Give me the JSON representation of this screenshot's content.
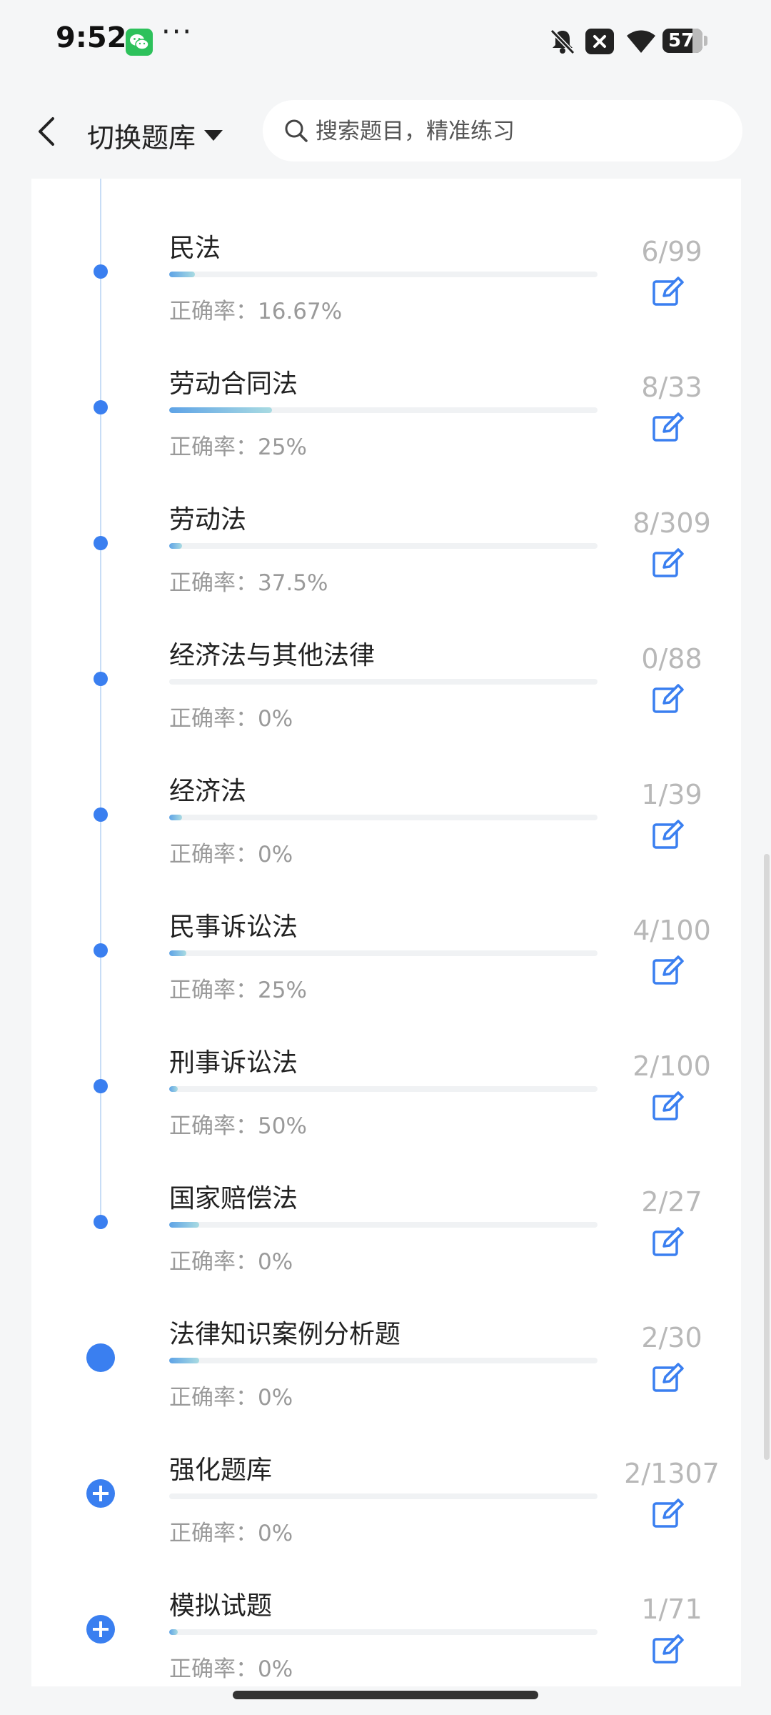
{
  "status_bar": {
    "time": "9:52",
    "dots": "···",
    "battery": "57",
    "icons": [
      "wechat-icon",
      "bell-muted-icon",
      "x-notification-icon",
      "wifi-icon",
      "battery-icon"
    ]
  },
  "header": {
    "switch_label": "切换题库",
    "search_placeholder": "搜索题目，精准练习"
  },
  "colors": {
    "accent": "#3a7ff0",
    "bar_start": "#5ea3e6",
    "bar_end": "#a9dbe2",
    "muted_text": "#9a9a9a",
    "count_text": "#b8b8b8"
  },
  "items": [
    {
      "title": "民法",
      "accuracy": "正确率：16.67%",
      "count": "6/99",
      "marker": "dot",
      "progress": 0.06
    },
    {
      "title": "劳动合同法",
      "accuracy": "正确率：25%",
      "count": "8/33",
      "marker": "dot",
      "progress": 0.24
    },
    {
      "title": "劳动法",
      "accuracy": "正确率：37.5%",
      "count": "8/309",
      "marker": "dot",
      "progress": 0.03
    },
    {
      "title": "经济法与其他法律",
      "accuracy": "正确率：0%",
      "count": "0/88",
      "marker": "dot",
      "progress": 0.0
    },
    {
      "title": "经济法",
      "accuracy": "正确率：0%",
      "count": "1/39",
      "marker": "dot",
      "progress": 0.03
    },
    {
      "title": "民事诉讼法",
      "accuracy": "正确率：25%",
      "count": "4/100",
      "marker": "dot",
      "progress": 0.04
    },
    {
      "title": "刑事诉讼法",
      "accuracy": "正确率：50%",
      "count": "2/100",
      "marker": "dot",
      "progress": 0.02
    },
    {
      "title": "国家赔偿法",
      "accuracy": "正确率：0%",
      "count": "2/27",
      "marker": "dot",
      "progress": 0.07
    },
    {
      "title": "法律知识案例分析题",
      "accuracy": "正确率：0%",
      "count": "2/30",
      "marker": "big-dot",
      "progress": 0.07
    },
    {
      "title": "强化题库",
      "accuracy": "正确率：0%",
      "count": "2/1307",
      "marker": "plus",
      "progress": 0.0
    },
    {
      "title": "模拟试题",
      "accuracy": "正确率：0%",
      "count": "1/71",
      "marker": "plus",
      "progress": 0.01
    }
  ]
}
